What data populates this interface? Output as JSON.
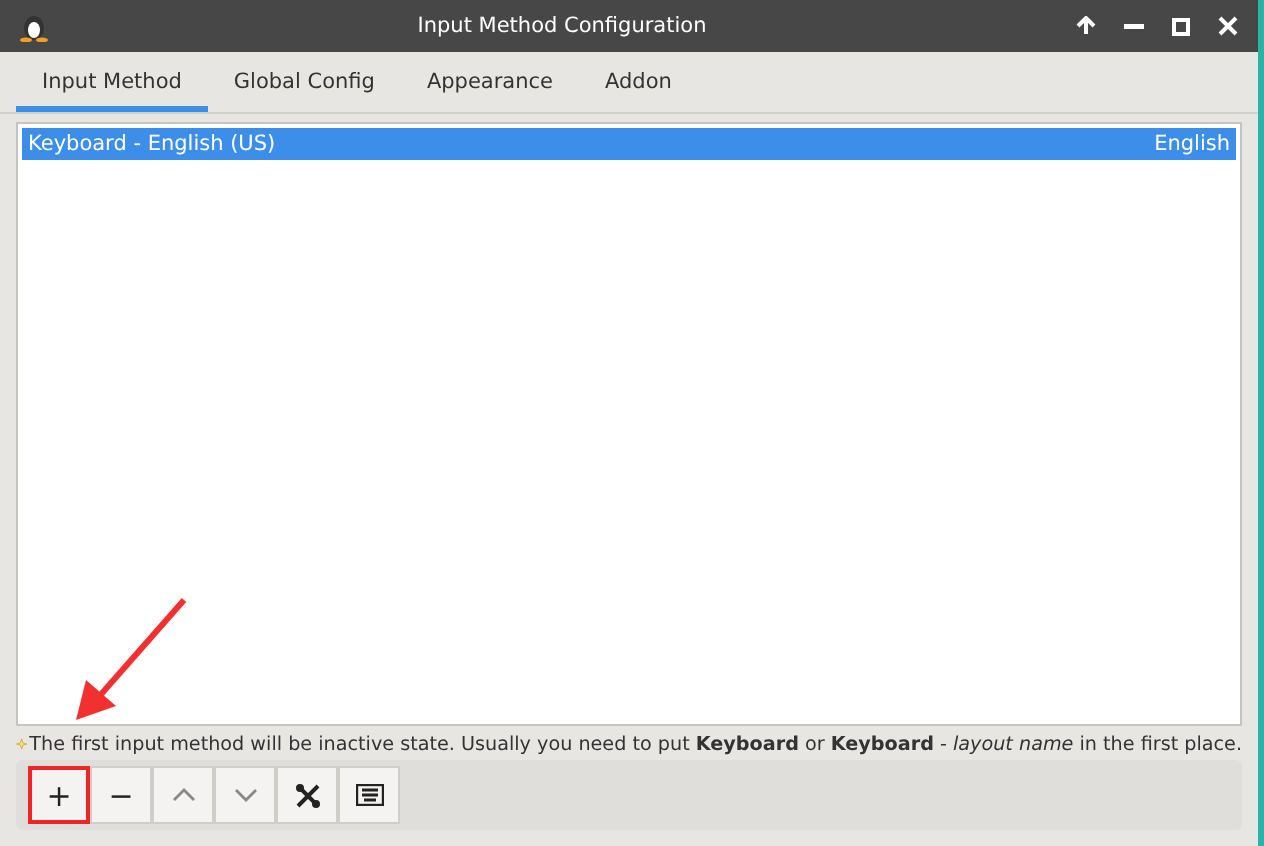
{
  "window": {
    "title": "Input Method Configuration"
  },
  "tabs": [
    {
      "label": "Input Method",
      "selected": true
    },
    {
      "label": "Global Config",
      "selected": false
    },
    {
      "label": "Appearance",
      "selected": false
    },
    {
      "label": "Addon",
      "selected": false
    }
  ],
  "input_methods": [
    {
      "name": "Keyboard - English (US)",
      "language": "English",
      "selected": true
    }
  ],
  "hint": "The first input method will be inactive state. Usually you need to put **Keyboard** or **Keyboard** - *layout name* in the first place.",
  "toolbar": [
    {
      "kind": "text",
      "label": "+",
      "highlighted": true
    },
    {
      "kind": "text",
      "label": "−",
      "highlighted": false
    },
    {
      "kind": "up",
      "highlighted": false
    },
    {
      "kind": "down",
      "highlighted": false
    },
    {
      "kind": "tools",
      "highlighted": false
    },
    {
      "kind": "keyboard",
      "highlighted": false
    }
  ]
}
